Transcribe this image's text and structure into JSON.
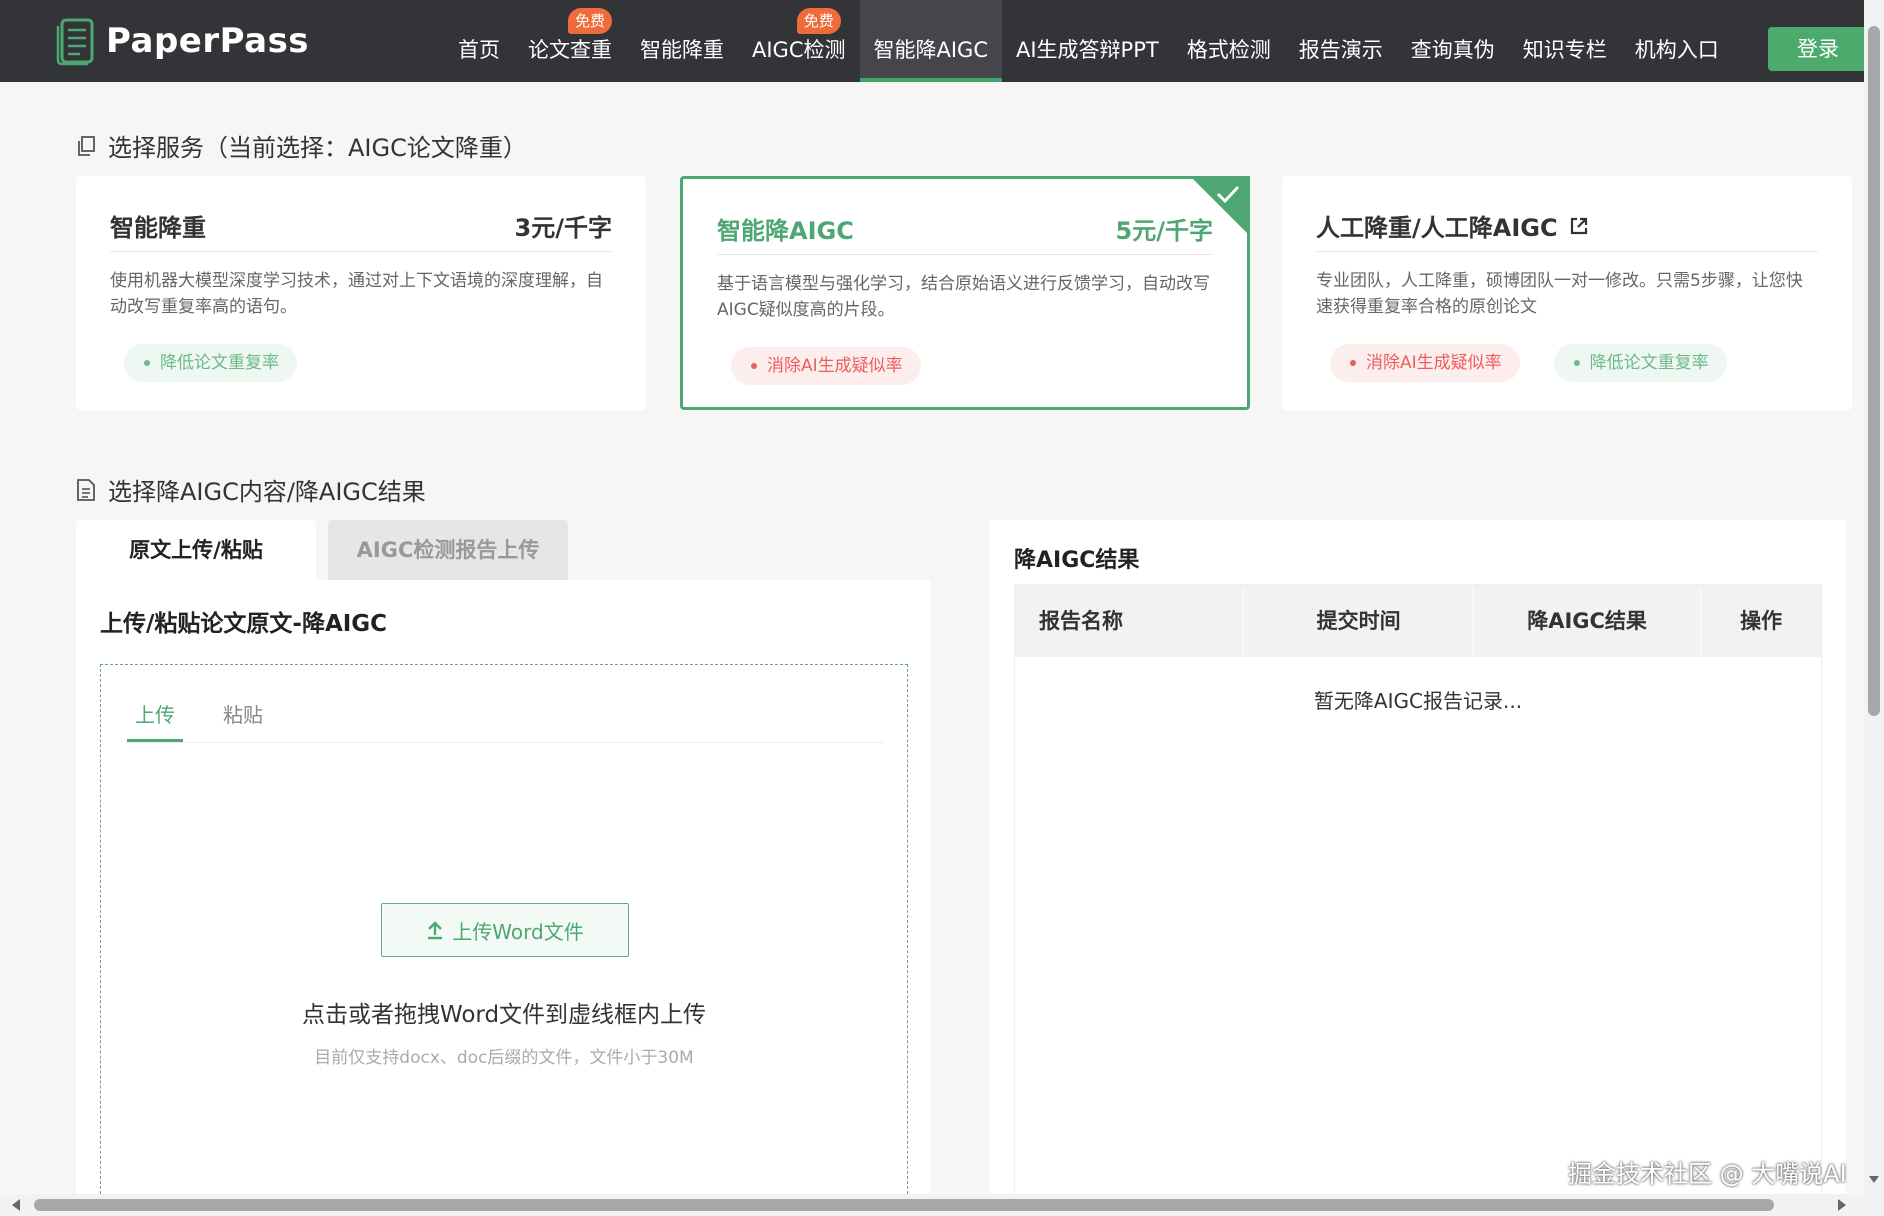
{
  "brand": {
    "name": "PaperPass"
  },
  "nav": {
    "items": [
      {
        "label": "首页",
        "badge": ""
      },
      {
        "label": "论文查重",
        "badge": "免费"
      },
      {
        "label": "智能降重",
        "badge": ""
      },
      {
        "label": "AIGC检测",
        "badge": "免费"
      },
      {
        "label": "智能降AIGC",
        "badge": "",
        "active": true
      },
      {
        "label": "AI生成答辩PPT",
        "badge": ""
      },
      {
        "label": "格式检测",
        "badge": ""
      },
      {
        "label": "报告演示",
        "badge": ""
      },
      {
        "label": "查询真伪",
        "badge": ""
      },
      {
        "label": "知识专栏",
        "badge": ""
      },
      {
        "label": "机构入口",
        "badge": ""
      }
    ],
    "login_label": "登录"
  },
  "service_section": {
    "title": "选择服务（当前选择：AIGC论文降重）"
  },
  "services": [
    {
      "name": "智能降重",
      "price": "3元/千字",
      "description": "使用机器大模型深度学习技术，通过对上下文语境的深度理解，自动改写重复率高的语句。",
      "tags": [
        {
          "label": "降低论文重复率",
          "tone": "green"
        }
      ]
    },
    {
      "name": "智能降AIGC",
      "price": "5元/千字",
      "description": "基于语言模型与强化学习，结合原始语义进行反馈学习，自动改写AIGC疑似度高的片段。",
      "tags": [
        {
          "label": "消除AI生成疑似率",
          "tone": "red"
        }
      ],
      "selected": true
    },
    {
      "name": "人工降重/人工降AIGC",
      "price": "",
      "description": "专业团队，人工降重，硕博团队一对一修改。只需5步骤，让您快速获得重复率合格的原创论文",
      "tags": [
        {
          "label": "消除AI生成疑似率",
          "tone": "red"
        },
        {
          "label": "降低论文重复率",
          "tone": "green"
        }
      ]
    }
  ],
  "content_section": {
    "title": "选择降AIGC内容/降AIGC结果"
  },
  "left_tabs": {
    "active": "原文上传/粘贴",
    "inactive": "AIGC检测报告上传"
  },
  "upload_panel": {
    "title": "上传/粘贴论文原文-降AIGC",
    "sub_tab_upload": "上传",
    "sub_tab_paste": "粘贴",
    "upload_button": "上传Word文件",
    "hint": "点击或者拖拽Word文件到虚线框内上传",
    "note": "目前仅支持docx、doc后缀的文件，文件小于30M"
  },
  "results": {
    "title": "降AIGC结果",
    "columns": [
      "报告名称",
      "提交时间",
      "降AIGC结果",
      "操作"
    ],
    "empty_text": "暂无降AIGC报告记录..."
  },
  "watermark": "掘金技术社区 @ 大嘴说AI",
  "colors": {
    "accent": "#4ea772",
    "topbar": "#333438",
    "badge": "#f06b3a",
    "danger": "#ee5d5d"
  }
}
